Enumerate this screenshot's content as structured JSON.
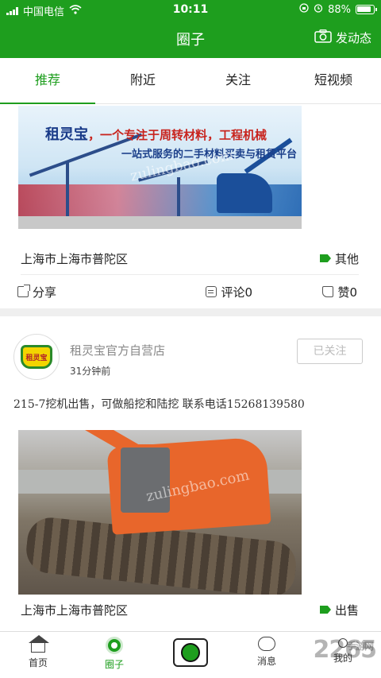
{
  "status": {
    "carrier": "中国电信",
    "time": "10:11",
    "battery": "88%"
  },
  "header": {
    "title": "圈子",
    "post_label": "发动态"
  },
  "tabs": [
    {
      "label": "推荐",
      "active": true
    },
    {
      "label": "附近",
      "active": false
    },
    {
      "label": "关注",
      "active": false
    },
    {
      "label": "短视频",
      "active": false
    }
  ],
  "posts": [
    {
      "banner": {
        "brand": "租灵宝",
        "line1": "，一个专注于周转材料，工程机械",
        "line2": "一站式服务的二手材料买卖与租赁平台"
      },
      "location": "上海市上海市普陀区",
      "tag": "其他",
      "share_label": "分享",
      "comment_label": "评论0",
      "like_label": "赞0"
    },
    {
      "shop_name": "租灵宝官方自营店",
      "time": "31分钟前",
      "follow_label": "已关注",
      "text": "215-7挖机出售，可做船挖和陆挖 联系电话15268139580",
      "location": "上海市上海市普陀区",
      "tag": "出售",
      "avatar_text": "租灵宝"
    }
  ],
  "bottom_nav": [
    {
      "label": "首页",
      "icon": "home-icon"
    },
    {
      "label": "圈子",
      "icon": "circle-icon",
      "active": true
    },
    {
      "label": "",
      "icon": "camera-icon"
    },
    {
      "label": "消息",
      "icon": "message-icon"
    },
    {
      "label": "我的",
      "icon": "user-icon"
    }
  ],
  "watermark": "2265",
  "watermark_sub": "手游网",
  "image_watermark": "zulingbao.com",
  "colors": {
    "brand_green": "#1e9e1e"
  }
}
